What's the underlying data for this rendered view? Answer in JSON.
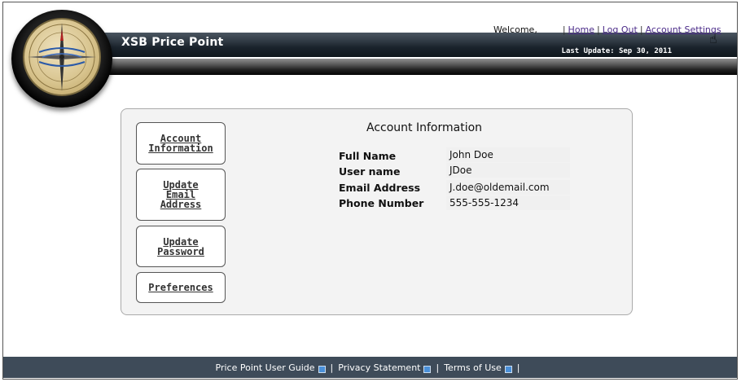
{
  "header": {
    "app_title": "XSB Price Point",
    "last_update": "Last Update: Sep 30, 2011",
    "welcome": "Welcome,",
    "links": [
      {
        "label": "Home"
      },
      {
        "label": "Log Out"
      },
      {
        "label": "Account Settings"
      }
    ]
  },
  "sidebar": {
    "buttons": [
      {
        "lines": [
          "Account",
          "Information"
        ]
      },
      {
        "lines": [
          "Update",
          "Email",
          "Address"
        ]
      },
      {
        "lines": [
          "Update",
          "Password"
        ]
      },
      {
        "lines": [
          "Preferences"
        ]
      }
    ]
  },
  "account": {
    "title": "Account Information",
    "fields": [
      {
        "label": "Full Name",
        "value": "John Doe"
      },
      {
        "label": "User name",
        "value": "JDoe"
      },
      {
        "label": "Email Address",
        "value": "J.doe@oldemail.com"
      },
      {
        "label": "Phone Number",
        "value": "555-555-1234"
      }
    ]
  },
  "footer": {
    "links": [
      {
        "label": "Price Point User Guide"
      },
      {
        "label": "Privacy Statement"
      },
      {
        "label": "Terms of Use"
      }
    ],
    "separator": "|"
  }
}
